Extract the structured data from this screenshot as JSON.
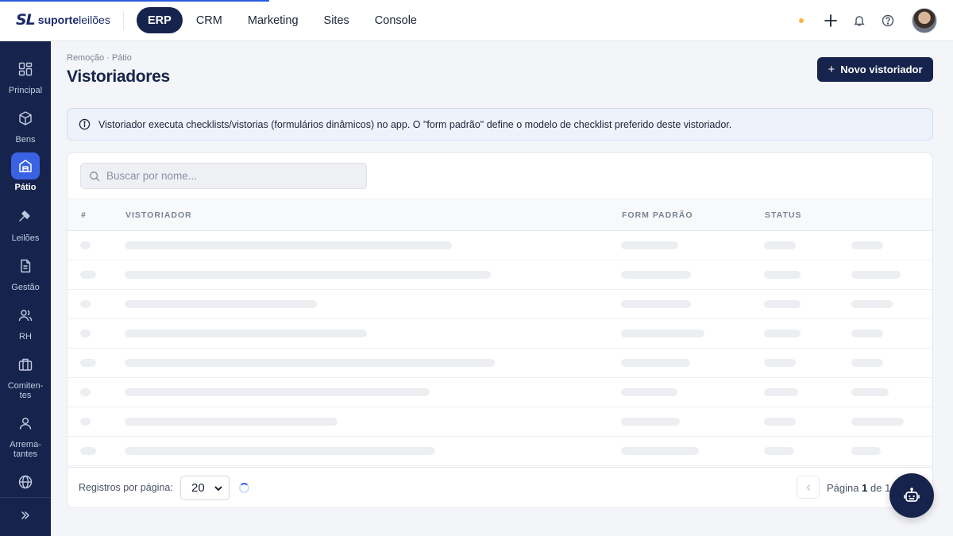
{
  "brand": {
    "mark": "SL",
    "name_bold": "suporte",
    "name_light": "leilões"
  },
  "nav": [
    {
      "label": "ERP",
      "active": true
    },
    {
      "label": "CRM",
      "active": false
    },
    {
      "label": "Marketing",
      "active": false
    },
    {
      "label": "Sites",
      "active": false
    },
    {
      "label": "Console",
      "active": false
    }
  ],
  "sidebar": [
    {
      "label": "Principal",
      "icon": "grid-icon",
      "active": false
    },
    {
      "label": "Bens",
      "icon": "box-icon",
      "active": false
    },
    {
      "label": "Pátio",
      "icon": "warehouse-icon",
      "active": true
    },
    {
      "label": "Leilões",
      "icon": "gavel-icon",
      "active": false
    },
    {
      "label": "Gestão",
      "icon": "document-icon",
      "active": false
    },
    {
      "label": "RH",
      "icon": "users-icon",
      "active": false
    },
    {
      "label": "Comiten-tes",
      "icon": "briefcase-icon",
      "active": false
    },
    {
      "label": "Arrema-tantes",
      "icon": "user-icon",
      "active": false
    },
    {
      "label": "",
      "icon": "globe-icon",
      "active": false
    }
  ],
  "page": {
    "breadcrumb": "Remoção · Pátio",
    "title": "Vistoriadores",
    "new_button": "Novo vistoriador",
    "info": "Vistoriador executa checklists/vistorias (formulários dinâmicos) no app. O \"form padrão\" define o modelo de checklist preferido deste vistoriador."
  },
  "search": {
    "placeholder": "Buscar por nome..."
  },
  "table": {
    "columns": [
      "#",
      "VISTORIADOR",
      "FORM PADRÃO",
      "STATUS",
      ""
    ],
    "loading_rows": 8
  },
  "pagination": {
    "per_page_label": "Registros por página:",
    "per_page_value": "20",
    "page_prefix": "Página",
    "current_page": "1",
    "page_of": "de",
    "total_pages": "1"
  },
  "colors": {
    "primary": "#16244d",
    "accent": "#3b62e3",
    "status_dot": "#f2b544"
  }
}
